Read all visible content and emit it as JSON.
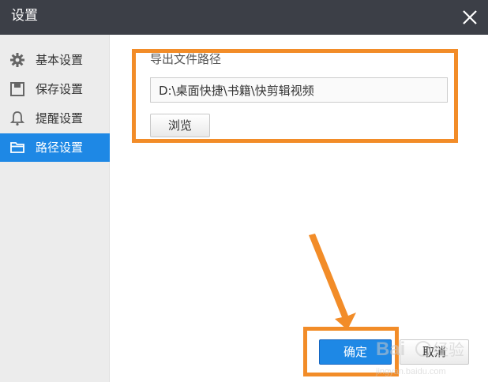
{
  "window": {
    "title": "设置"
  },
  "sidebar": {
    "items": [
      {
        "label": "基本设置",
        "icon": "gear-icon"
      },
      {
        "label": "保存设置",
        "icon": "save-icon"
      },
      {
        "label": "提醒设置",
        "icon": "bell-icon"
      },
      {
        "label": "路径设置",
        "icon": "folder-icon",
        "active": true
      }
    ]
  },
  "path_settings": {
    "section_label": "导出文件路径",
    "path_value": "D:\\桌面快捷\\书籍\\快剪辑视频",
    "browse_label": "浏览"
  },
  "footer": {
    "ok_label": "确定",
    "cancel_label": "取消"
  },
  "annotation": {
    "color": "#f28c28"
  },
  "colors": {
    "titlebar": "#3c3f47",
    "accent": "#1e88e5",
    "sidebar": "#ececec"
  }
}
